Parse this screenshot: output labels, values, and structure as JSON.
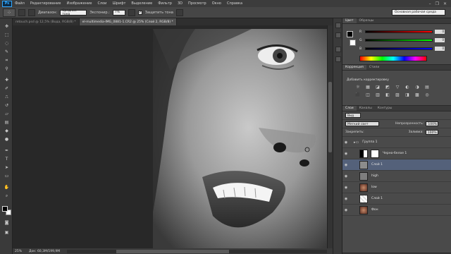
{
  "app": {
    "logo": "Ps"
  },
  "menu": [
    "Файл",
    "Редактирование",
    "Изображение",
    "Слои",
    "Шрифт",
    "Выделение",
    "Фильтр",
    "3D",
    "Просмотр",
    "Окно",
    "Справка"
  ],
  "window_controls": {
    "minimize": "–",
    "restore": "❐",
    "close": "✕"
  },
  "options": {
    "tool_icon": "⁘",
    "mode_label": "Диапазон:",
    "mode_value": "Средние тона",
    "exposure_label": "Экспонир.:",
    "exposure_value": "7%",
    "protect_label": "Защитить тона",
    "protect_check": "✓",
    "workspace": "Основная рабочая среда"
  },
  "doc_tabs": [
    {
      "label": "retouch.psd @ 12,5% (Вода, RGB/8) *",
      "active": false
    },
    {
      "label": "el-multimedia-IMG_0881-1.CR2 @ 25% (Слой 2, RGB/8) *",
      "active": true
    }
  ],
  "status": {
    "zoom": "25%",
    "doc_size": "Док: 60,3M/199,9M"
  },
  "panels": {
    "color_tabs": [
      "Цвет",
      "Образцы"
    ],
    "color_sliders": [
      {
        "channel": "R",
        "value": "0",
        "gradient": "#ff0000"
      },
      {
        "channel": "G",
        "value": "0",
        "gradient": "#00ff00"
      },
      {
        "channel": "B",
        "value": "0",
        "gradient": "#0000ff"
      }
    ],
    "adjust_tabs": [
      "Коррекция",
      "Стили"
    ],
    "adjust_title": "Добавить корректировку",
    "adjust_icons": [
      "☼",
      "▦",
      "◪",
      "◩",
      "▽",
      "◐",
      "◑",
      "▤",
      "⬛",
      "◫",
      "▥",
      "◧",
      "▨",
      "◨",
      "▩",
      "◎"
    ],
    "layers_tabs": [
      "Слои",
      "Каналы",
      "Контуры"
    ],
    "filter": "Вид",
    "blend_mode": "Мягкий свет",
    "opacity_label": "Непрозрачность:",
    "opacity_value": "100%",
    "lock_label": "Закрепить:",
    "fill_label": "Заливка:",
    "fill_value": "100%",
    "layers": [
      {
        "name": "Группа 1",
        "kind": "group",
        "selected": false
      },
      {
        "name": "Черно-белое 1",
        "kind": "adjustment",
        "selected": false
      },
      {
        "name": "Слой 1",
        "kind": "gray",
        "selected": true
      },
      {
        "name": "high",
        "kind": "gray",
        "selected": false
      },
      {
        "name": "low",
        "kind": "photo",
        "selected": false
      },
      {
        "name": "Слой 1",
        "kind": "empty",
        "selected": false
      },
      {
        "name": "Фон",
        "kind": "photo",
        "selected": false
      }
    ],
    "footer_icons": [
      "⛓",
      "fx",
      "◐",
      "◑",
      "▭",
      "▣",
      "🗑"
    ]
  },
  "colors": {
    "accent": "#31a8ff",
    "selected_layer": "#54617a",
    "panel_bg": "#4a4a4a",
    "ui_dark": "#2b2b2b"
  }
}
